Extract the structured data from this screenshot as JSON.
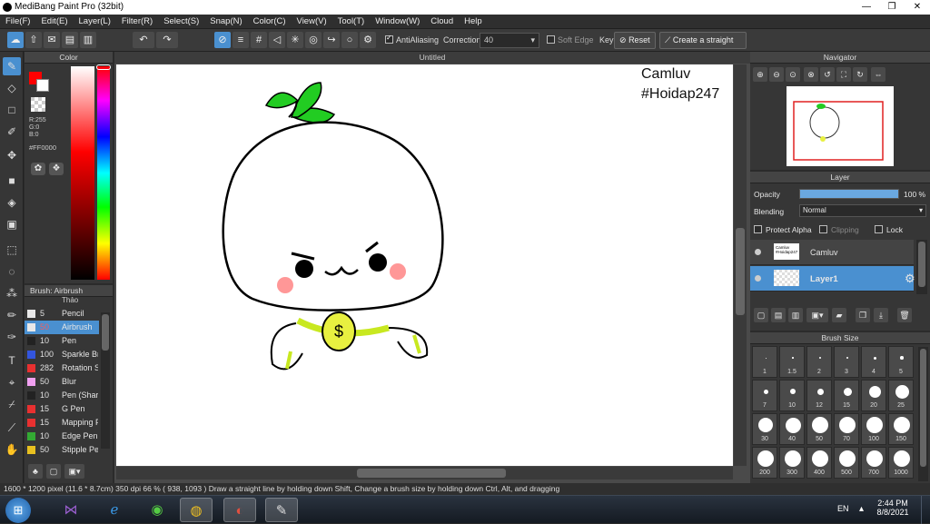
{
  "title_bar": {
    "title": "MediBang Paint Pro (32bit)",
    "minimize": "—",
    "maximize": "❐",
    "close": "✕"
  },
  "menu": [
    "File(F)",
    "Edit(E)",
    "Layer(L)",
    "Filter(R)",
    "Select(S)",
    "Snap(N)",
    "Color(C)",
    "View(V)",
    "Tool(T)",
    "Window(W)",
    "Cloud",
    "Help"
  ],
  "toolbar": {
    "antialiasing_label": "AntiAliasing",
    "correction_label": "Correction",
    "correction_value": "40",
    "soft_edge_label": "Soft Edge",
    "key_label": "Key",
    "reset_label": "Reset",
    "straight_line_label": "Create a straight line"
  },
  "color_panel": {
    "title": "Color",
    "r": "R:255",
    "g": "G:0",
    "b": "B:0",
    "hex": "#FF0000",
    "primary_color": "#ff0000"
  },
  "brush_panel": {
    "title": "Brush: Airbrush",
    "partial_top": "Thảo",
    "items": [
      {
        "size": "5",
        "name": "Pencil",
        "color": "#e8e8e8"
      },
      {
        "size": "50",
        "name": "Airbrush",
        "color": "#e8e8e8"
      },
      {
        "size": "10",
        "name": "Pen",
        "color": "#222222"
      },
      {
        "size": "100",
        "name": "Sparkle Brush",
        "color": "#3355dd"
      },
      {
        "size": "282",
        "name": "Rotation Symmetry",
        "color": "#e83030"
      },
      {
        "size": "50",
        "name": "Blur",
        "color": "#f0a0f0"
      },
      {
        "size": "10",
        "name": "Pen (Sharp)",
        "color": "#222222"
      },
      {
        "size": "15",
        "name": "G Pen",
        "color": "#e83030"
      },
      {
        "size": "15",
        "name": "Mapping Pen",
        "color": "#e83030"
      },
      {
        "size": "10",
        "name": "Edge Pen",
        "color": "#33aa33"
      },
      {
        "size": "50",
        "name": "Stipple Pen",
        "color": "#e8c020"
      }
    ]
  },
  "canvas": {
    "tab": "Untitled",
    "watermark_line1": "Camluv",
    "watermark_line2": "#Hoidap247"
  },
  "navigator": {
    "title": "Navigator"
  },
  "layer_panel": {
    "title": "Layer",
    "opacity_label": "Opacity",
    "opacity_value": "100 %",
    "opacity_fraction": 1.0,
    "blending_label": "Blending",
    "blending_value": "Normal",
    "protect_alpha": "Protect Alpha",
    "clipping": "Clipping",
    "lock": "Lock",
    "layers": [
      {
        "name": "Camluv",
        "thumb_text": "Camluv #Hoidap247"
      },
      {
        "name": "Layer1"
      }
    ]
  },
  "brush_size": {
    "title": "Brush Size",
    "sizes": [
      "1",
      "1.5",
      "2",
      "3",
      "4",
      "5",
      "7",
      "10",
      "12",
      "15",
      "20",
      "25",
      "30",
      "40",
      "50",
      "70",
      "100",
      "150",
      "200",
      "300",
      "400",
      "500",
      "700",
      "1000"
    ]
  },
  "status": {
    "text": "1600 * 1200 pixel   (11.6 * 8.7cm)   350 dpi   66 %   ( 938, 1093 )   Draw a straight line by holding down Shift, Change a brush size by holding down Ctrl, Alt, and dragging"
  },
  "taskbar": {
    "lang": "EN",
    "time": "2:44 PM",
    "date": "8/8/2021"
  },
  "colors": {
    "accent": "#4a90d0",
    "panel": "#363636",
    "canvas": "#ffffff"
  }
}
